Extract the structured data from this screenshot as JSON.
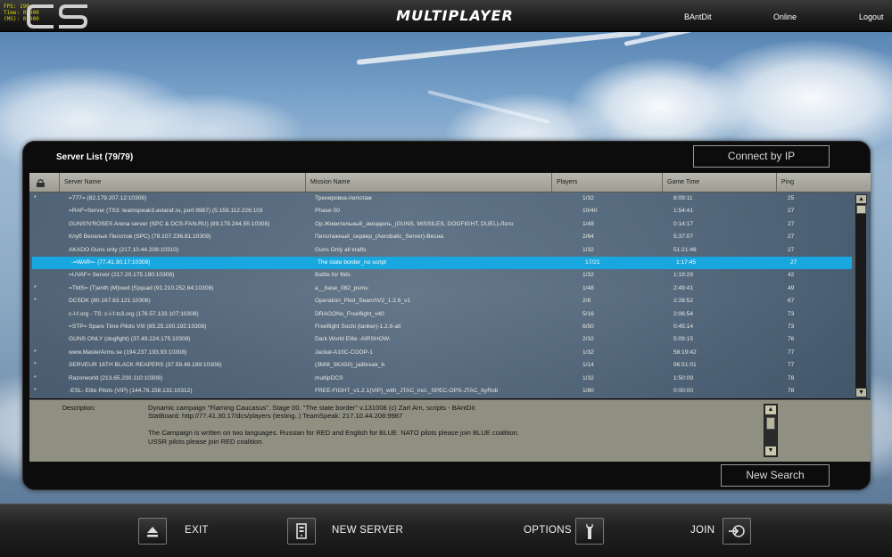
{
  "hud": {
    "fps": "FPS:  190",
    "time": "Time: 0.000",
    "ms": "(MS): 0.000"
  },
  "app": {
    "title": "MULTIPLAYER"
  },
  "top_menu": {
    "user": "BAntDit",
    "status": "Online",
    "logout": "Logout"
  },
  "server_list": {
    "title": "Server List (79/79)",
    "connect_by_ip": "Connect by IP",
    "new_search": "New Search",
    "columns": {
      "lock": "",
      "name": "Server Name",
      "mission": "Mission Name",
      "players": "Players",
      "time": "Game Time",
      "ping": "Ping"
    },
    "rows": [
      {
        "flag": "*",
        "name": "=777= (82.179.207.12:10308)",
        "mission": "Тренировка-пилотаж",
        "players": "1/32",
        "time": "8:09:11",
        "ping": "25"
      },
      {
        "flag": "",
        "name": "=RAF=Server   (TS3: teamspeak3.aviaraf.ru, port 9987) (5.159.112.226:103",
        "mission": "Phase 00",
        "players": "10/40",
        "time": "1:54:41",
        "ping": "27"
      },
      {
        "flag": "",
        "name": "GUNS'N'ROSES Arena server (SPC & DCS-FAN.RU) (89.179.244.55:10308)",
        "mission": "Ор.Живительный_звездюль_(GUNS, MISSILES, DOGFIGHT, DUEL)-Лето",
        "players": "1/48",
        "time": "0:14:17",
        "ping": "27"
      },
      {
        "flag": "",
        "name": "Клуб Веселых Пилотов (SPC) (78.107.236.81:10309)",
        "mission": "Пилотажный_сервер_(Aerobatic_Server)-Весна",
        "players": "2/64",
        "time": "5:37:07",
        "ping": "27"
      },
      {
        "flag": "",
        "name": "AKADO Guns only (217.10.44.208:10310)",
        "mission": "Guns Only all krafts",
        "players": "1/32",
        "time": "51:21:46",
        "ping": "27"
      },
      {
        "flag": "",
        "name": "-=WAR=- (77.41.30.17:10308)",
        "mission": "The state border_no script",
        "players": "17/21",
        "time": "1:17:45",
        "ping": "27",
        "selected": true
      },
      {
        "flag": "",
        "name": "=UVAF= Server (217.20.175.190:10308)",
        "mission": "Battle for filds",
        "players": "1/32",
        "time": "1:19:29",
        "ping": "42"
      },
      {
        "flag": "*",
        "name": "=TMS= (T)enth (M)ixed (S)quad (91.210.252.84:10308)",
        "mission": "a__base_082_psmu",
        "players": "1/48",
        "time": "2:49:41",
        "ping": "49"
      },
      {
        "flag": "*",
        "name": "DCSDK (80.167.83.121:10308)",
        "mission": "Operation_Pilot_SearchV2_1.2.6_v1",
        "players": "2/8",
        "time": "2:28:52",
        "ping": "67"
      },
      {
        "flag": "",
        "name": "c-l-f.org - TS: c-l-f-ts3.org (176.57.133.107:10308)",
        "mission": "DRAGONs_Freeflight_v40",
        "players": "5/16",
        "time": "2:06:54",
        "ping": "73"
      },
      {
        "flag": "",
        "name": "=STP= Spare Time Pilots VIII (85.25.100.192:10308)",
        "mission": "Freeflight Sochi (tanker)-1.2.6-all",
        "players": "6/50",
        "time": "0:45:14",
        "ping": "73"
      },
      {
        "flag": "",
        "name": "GUNS ONLY (dogfight) (37.49.224.175:10308)",
        "mission": "Dark World Elite -AIRSHOW-",
        "players": "2/32",
        "time": "5:09:15",
        "ping": "76"
      },
      {
        "flag": "*",
        "name": "www.MasterArms.se (194.237.193.93:10308)",
        "mission": "Jackal-A10C-COOP-1",
        "players": "1/32",
        "time": "58:19:42",
        "ping": "77"
      },
      {
        "flag": "*",
        "name": "SERVEUR 16TH BLACK REAPERS (37.59.49.189:10308)",
        "mission": "(3MI8_3KA50)_jailbreak_b",
        "players": "1/14",
        "time": "96:51:01",
        "ping": "77"
      },
      {
        "flag": "*",
        "name": "Razorworld (213.65.230.110:10308)",
        "mission": "multipDCS",
        "players": "1/32",
        "time": "1:50:09",
        "ping": "78"
      },
      {
        "flag": "*",
        "name": "-ESL- Elite Pilots (VIP) (144.76.158.131:10312)",
        "mission": "FREE-FIGHT_v1.2.1(VIP)_with_JTAC_incl._SPEC-OPS-JTAC_byRob",
        "players": "1/80",
        "time": "0:00:00",
        "ping": "78"
      }
    ],
    "description_label": "Description:",
    "description": "Dynamic campaign \"Flaming Caucasus\". Stage 00. \"The state border\" v.131008 (c) Zart Arn, scripts - BAntDit\nStatBoard: http://77.41.30.17/dcs/players (testing..) TeamSpeak: 217.10.44.208:9987\n\nThe Campaign is written on two languages. Russian for RED and English for BLUE. NATO pilots please join BLUE coalition.\nUSSR pilots please join RED coalition."
  },
  "bottom_menu": {
    "exit": "EXIT",
    "new_server": "NEW SERVER",
    "options": "OPTIONS",
    "join": "JOIN"
  },
  "icons": [
    "eject-icon",
    "server-icon",
    "wrench-icon",
    "join-arrow-icon",
    "lock-icon"
  ],
  "colors": {
    "selected_row": "#19a7e0",
    "grid_bg": "#7e7e74",
    "panel_bg": "#0c0c0c"
  }
}
